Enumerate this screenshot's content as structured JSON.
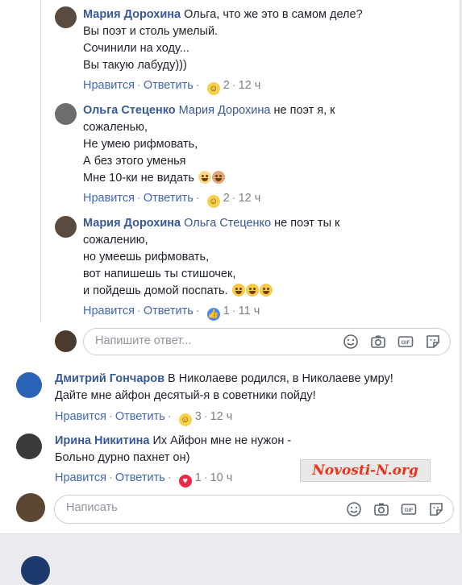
{
  "comments": {
    "c1": {
      "author": "Мария Дорохина",
      "text": " Ольга, что же это в самом деле?\nВы поэт и столь умелый.\nСочинили на ходу...\nВы такую лабуду)))",
      "like": "Нравится",
      "reply": "Ответить",
      "reaction_count": "2",
      "time": "12 ч"
    },
    "c2": {
      "author": "Ольга Стеценко",
      "mention": "Мария Дорохина",
      "text": " не поэт я, к\nсожаленью,\nНе умею рифмовать,\nА без этого уменья\nМне 10-ки не видать",
      "like": "Нравится",
      "reply": "Ответить",
      "reaction_count": "2",
      "time": "12 ч"
    },
    "c3": {
      "author": "Мария Дорохина",
      "mention": "Ольга Стеценко",
      "text": " не поэт ты к\nсожалению,\nно умеешь рифмовать,\nвот напишешь ты стишочек,\nи пойдешь домой поспать.",
      "like": "Нравится",
      "reply": "Ответить",
      "reaction_count": "1",
      "time": "11 ч"
    },
    "c4": {
      "author": "Дмитрий Гончаров",
      "text": " В Николаеве родился, в Николаеве умру!\nДайте мне айфон десятый-я в советники пойду!",
      "like": "Нравится",
      "reply": "Ответить",
      "reaction_count": "3",
      "time": "12 ч"
    },
    "c5": {
      "author": "Ирина Никитина",
      "text": " Их Айфон мне не нужон -\nБольно дурно пахнет он)",
      "like": "Нравится",
      "reply": "Ответить",
      "reaction_count": "1",
      "time": "10 ч"
    }
  },
  "reply_box": {
    "placeholder": "Напишите ответ..."
  },
  "comment_box": {
    "placeholder": "Написать"
  },
  "watermark": "Novosti-N.org",
  "icons": [
    "emoji-icon",
    "camera-icon",
    "gif-icon",
    "sticker-icon"
  ],
  "colors": {
    "link": "#4267b2",
    "name": "#385898",
    "watermark": "#e8341a"
  }
}
